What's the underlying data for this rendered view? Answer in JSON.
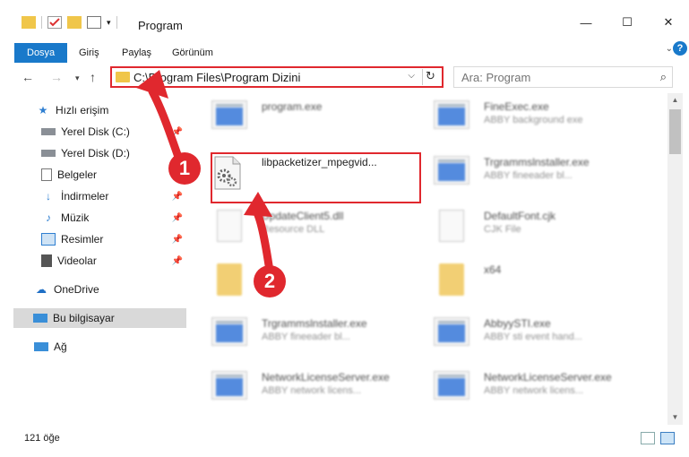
{
  "window": {
    "title": "Program"
  },
  "ribbon": {
    "tabs": [
      {
        "label": "Dosya",
        "active": true
      },
      {
        "label": "Giriş"
      },
      {
        "label": "Paylaş"
      },
      {
        "label": "Görünüm"
      }
    ]
  },
  "address": {
    "path": "C:\\Program Files\\Program Dizini",
    "search_placeholder": "Ara: Program"
  },
  "sidebar": {
    "quick_access": "Hızlı erişim",
    "items": [
      {
        "label": "Yerel Disk (C:)",
        "pinned": true
      },
      {
        "label": "Yerel Disk (D:)"
      },
      {
        "label": "Belgeler",
        "pinned": true
      },
      {
        "label": "İndirmeler",
        "pinned": true
      },
      {
        "label": "Müzik",
        "pinned": true
      },
      {
        "label": "Resimler",
        "pinned": true
      },
      {
        "label": "Videolar",
        "pinned": true
      }
    ],
    "onedrive": "OneDrive",
    "this_pc": "Bu bilgisayar",
    "network": "Ağ"
  },
  "files": [
    {
      "name": "program.exe",
      "desc": ""
    },
    {
      "name": "FineExec.exe",
      "desc": "ABBY background exe"
    },
    {
      "name": "libpacketizer_mpegvid...",
      "desc": ""
    },
    {
      "name": "Trgrammslnstaller.exe",
      "desc": "ABBY fineeader bl..."
    },
    {
      "name": "UpdateClient5.dll",
      "desc": "Resource DLL"
    },
    {
      "name": "DefaultFont.cjk",
      "desc": "CJK File"
    },
    {
      "name": "",
      "desc": ""
    },
    {
      "name": "x64",
      "desc": ""
    },
    {
      "name": "Trgrammslnstaller.exe",
      "desc": "ABBY fineeader bl..."
    },
    {
      "name": "AbbyySTI.exe",
      "desc": "ABBY sti event hand..."
    },
    {
      "name": "NetworkLicenseServer.exe",
      "desc": "ABBY network licens..."
    },
    {
      "name": "NetworkLicenseServer.exe",
      "desc": "ABBY network licens..."
    }
  ],
  "status": {
    "item_count": "121 öğe"
  },
  "callouts": {
    "one": "1",
    "two": "2"
  },
  "colors": {
    "accent": "#1979ca",
    "annotation_red": "#e0282e",
    "folder": "#f0c64a"
  }
}
